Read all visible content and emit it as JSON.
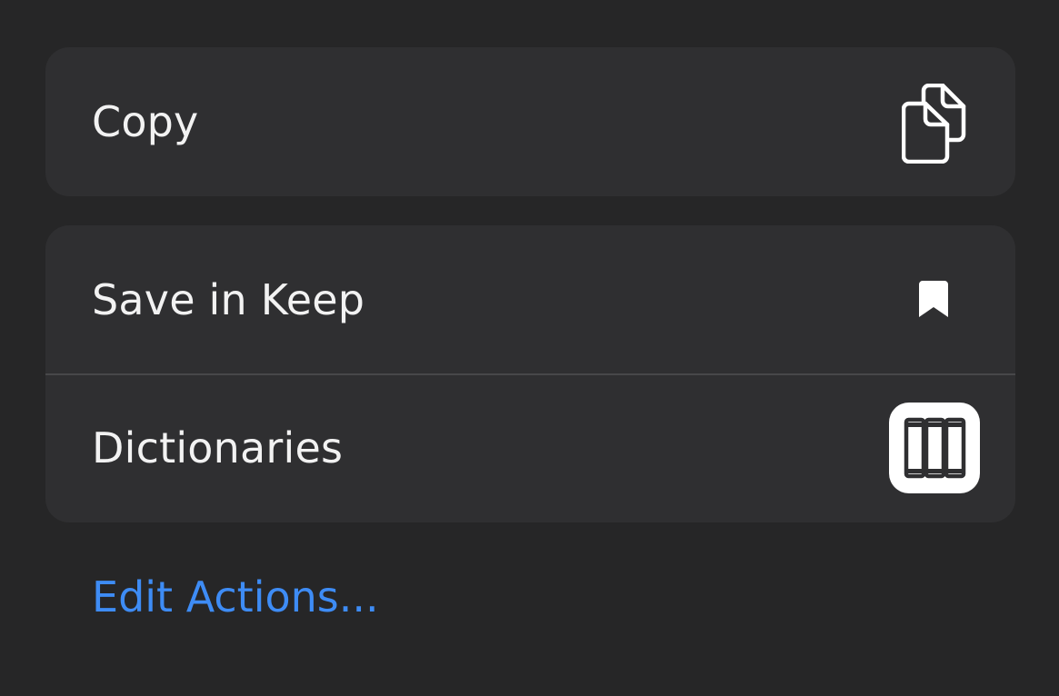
{
  "menu": {
    "copy": {
      "label": "Copy",
      "icon": "copy-icon"
    },
    "save_in_keep": {
      "label": "Save in Keep",
      "icon": "bookmark-icon"
    },
    "dictionaries": {
      "label": "Dictionaries",
      "icon": "dictionaries-app-icon"
    }
  },
  "edit_actions": {
    "label": "Edit Actions..."
  },
  "colors": {
    "background": "#262627",
    "row_background": "#2f2f31",
    "divider": "#474749",
    "text": "#f2f2f2",
    "link": "#3e8cf5"
  }
}
